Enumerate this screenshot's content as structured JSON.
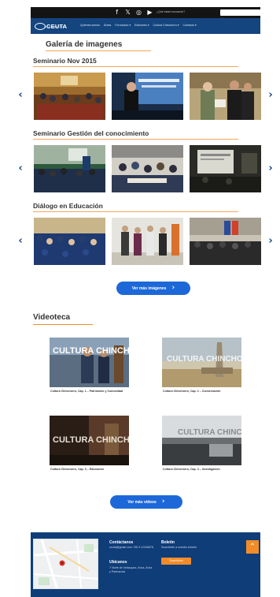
{
  "topbar": {
    "socials": [
      "facebook-icon",
      "x-icon",
      "instagram-icon",
      "youtube-icon"
    ],
    "social_glyphs": [
      "f",
      "𝕏",
      "◎",
      "▶"
    ],
    "search_prompt": "¿Qué estás buscando?",
    "search_placeholder": "Buscar...",
    "search_glyph": "⌕"
  },
  "nav": {
    "logo_text": "CEUTA",
    "logo_sub": "ARICA Y PARINACOTA",
    "menu": [
      "Quienes somos",
      "Áreas",
      "Formación ▾",
      "Ediciones ▾",
      "Cultura Chinchorro ▾",
      "Contacto ▾"
    ]
  },
  "gallery": {
    "title": "Galería de imagenes",
    "sections": [
      {
        "title": "Seminario Nov 2015"
      },
      {
        "title": "Seminario Gestión del conocimiento"
      },
      {
        "title": "Diálogo en Educación"
      }
    ],
    "prev_glyph": "‹",
    "next_glyph": "›",
    "more_label": "Ver más imágenes",
    "more_glyph": "›"
  },
  "videos": {
    "title": "Videoteca",
    "items": [
      {
        "caption": "Cultura Chinchorro, Cap. 1 – Patrimonio y Comunidad",
        "overlay": "CULTURA CHINCHORRO"
      },
      {
        "caption": "Cultura Chinchorro, Cap. 2 – Conservación",
        "overlay": "CULTURA CHINCHORRO"
      },
      {
        "caption": "Cultura Chinchorro, Cap. 3 – Educación",
        "overlay": "CULTURA CHINCHORRO"
      },
      {
        "caption": "Cultura Chinchorro, Cap. 4 – Investigación",
        "overlay": "CULTURA CHINCHORRO"
      }
    ],
    "more_label": "Ver más videos",
    "more_glyph": "›"
  },
  "footer": {
    "contact_title": "Contáctanos",
    "contact_text": "ceuta@gmail.com +56 9 12345678",
    "location_title": "Ubícanos",
    "location_text": "7 Norte de Velásquez, Arica, Arica y Parinacota",
    "newsletter_title": "Boletín",
    "newsletter_text": "Suscríbete a nuestro boletín",
    "subscribe_label": "Suscribirse",
    "totop_glyph": "⌃"
  },
  "colors": {
    "nav": "#14457f",
    "footer": "#0f3d78",
    "accent": "#f28c28",
    "button": "#1d68d8"
  }
}
